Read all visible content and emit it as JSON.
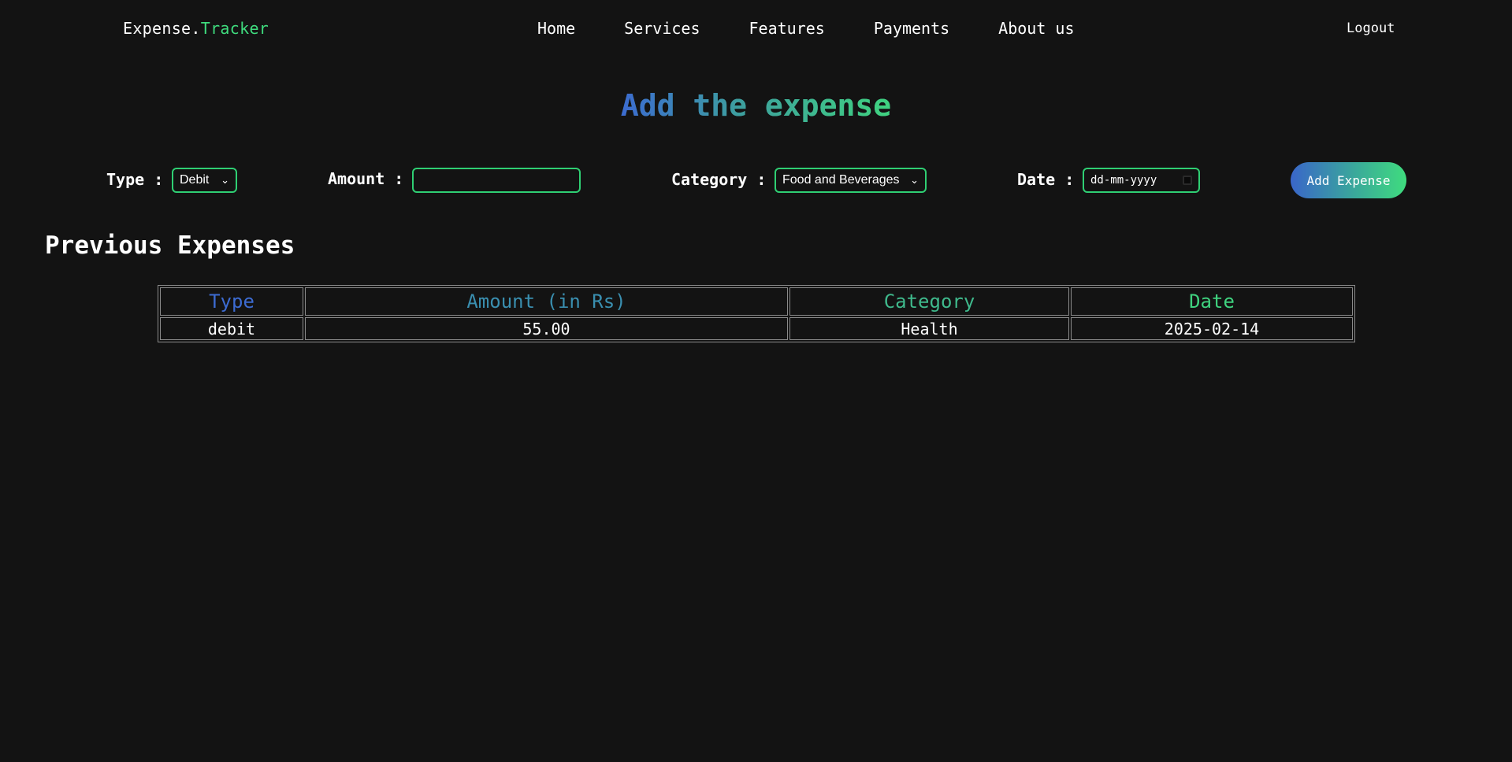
{
  "brand": {
    "prefix": "Expense.",
    "accent": "Tracker"
  },
  "nav": {
    "items": [
      "Home",
      "Services",
      "Features",
      "Payments",
      "About us"
    ],
    "logout": "Logout"
  },
  "heading": {
    "part1": "Add the expense"
  },
  "form": {
    "type_label": "Type :",
    "type_value": "Debit",
    "amount_label": "Amount :",
    "amount_value": "",
    "category_label": "Category :",
    "category_value": "Food and Beverages",
    "date_label": "Date :",
    "date_placeholder": "dd-mm-yyyy",
    "submit_label": "Add Expense"
  },
  "previous": {
    "title": "Previous Expenses",
    "columns": [
      "Type",
      "Amount (in Rs)",
      "Category",
      "Date"
    ],
    "column_colors": [
      "#3c6bd1",
      "#3a8fb0",
      "#3fb98c",
      "#3fd27f"
    ],
    "rows": [
      {
        "type": "debit",
        "amount": "55.00",
        "category": "Health",
        "date": "2025-02-14"
      }
    ]
  },
  "colors": {
    "background": "#131313",
    "accent_green": "#3fdc7e",
    "accent_blue": "#3c6bd1",
    "field_border": "#2fcf73"
  }
}
